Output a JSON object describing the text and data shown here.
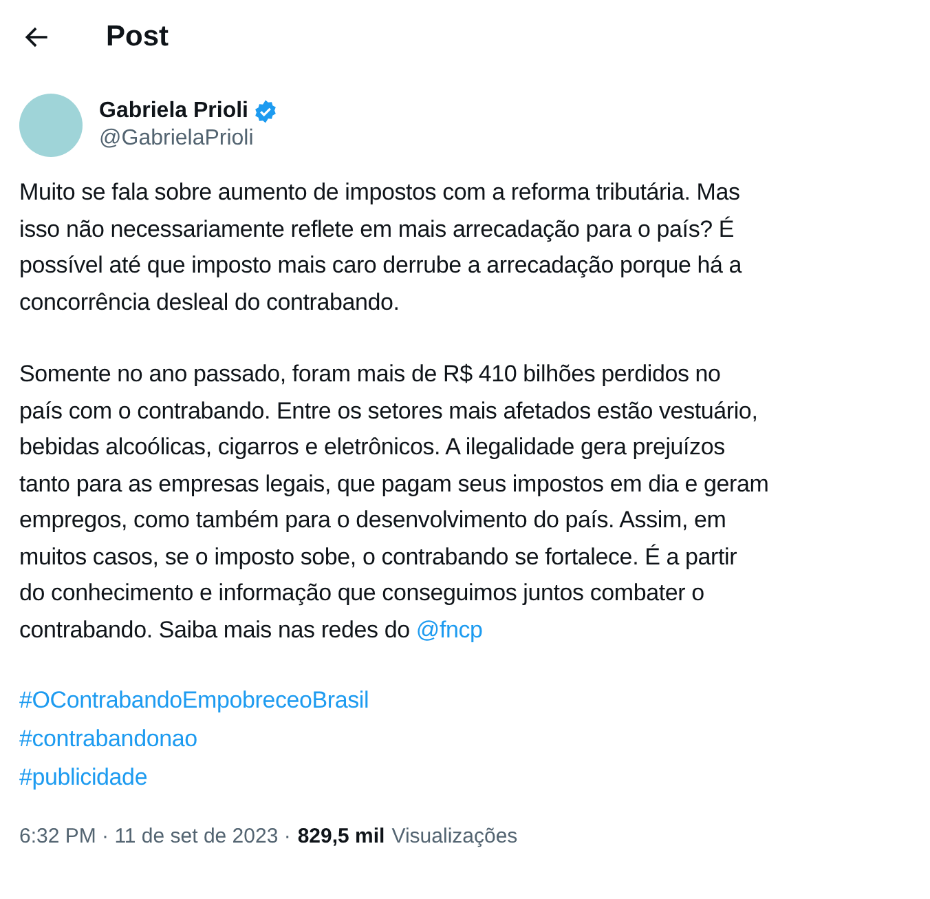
{
  "header": {
    "title": "Post"
  },
  "author": {
    "name": "Gabriela Prioli",
    "verified": true,
    "handle": "@GabrielaPrioli"
  },
  "paragraphs": [
    {
      "lines": [
        "Muito se fala sobre aumento de impostos com a reforma tributária. Mas",
        "isso não necessariamente reflete em mais arrecadação para o país? É",
        "possível até que imposto mais caro derrube a arrecadação porque há a",
        "concorrência desleal do contrabando."
      ]
    },
    {
      "lines": [
        "Somente no ano passado, foram mais de R$ 410 bilhões perdidos no",
        "país com o contrabando. Entre os setores mais afetados estão vestuário,",
        "bebidas alcoólicas, cigarros e eletrônicos. A ilegalidade gera prejuízos",
        "tanto para as empresas legais, que pagam seus impostos em dia e geram",
        "empregos, como também para o desenvolvimento do país. Assim, em",
        "muitos casos, se o imposto sobe, o contrabando se fortalece. É a partir",
        "do conhecimento e informação que conseguimos juntos combater o",
        "contrabando. Saiba mais nas redes do"
      ],
      "mention": "@fncp"
    }
  ],
  "hashtags": [
    "#OContrabandoEmpobreceoBrasil",
    "#contrabandonao",
    "#publicidade"
  ],
  "meta": {
    "time": "6:32 PM · 11 de set de 2023 ·",
    "views_count": "829,5 mil",
    "views_label": "Visualizações"
  }
}
